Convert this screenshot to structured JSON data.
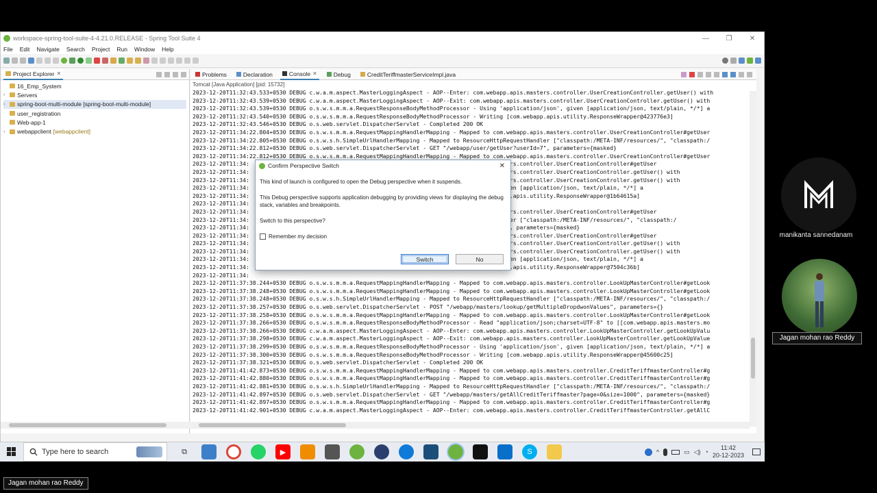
{
  "window": {
    "title": "workspace-spring-tool-suite-4-4.21.0.RELEASE - Spring Tool Suite 4",
    "controls": [
      "—",
      "❐",
      "✕"
    ]
  },
  "menubar": [
    "File",
    "Edit",
    "Navigate",
    "Search",
    "Project",
    "Run",
    "Window",
    "Help"
  ],
  "project_explorer": {
    "tab_label": "Project Explorer",
    "items": [
      {
        "label": "16_Emp_System",
        "sub": ""
      },
      {
        "label": "Servers",
        "sub": ""
      },
      {
        "label": "spring-boot-multi-module [spring-boot-multi-module]",
        "sub": ""
      },
      {
        "label": "user_registration",
        "sub": ""
      },
      {
        "label": "Web-app-1",
        "sub": ""
      },
      {
        "label": "webappclient",
        "sub": "[webappclient]"
      }
    ]
  },
  "editor_tabs": [
    "Problems",
    "Declaration",
    "Console",
    "Debug",
    "CreditTeriffmasterServiceImpl.java"
  ],
  "console": {
    "header": "Tomcat [Java Application]  [pid: 15732]",
    "lines": [
      "2023-12-20T11:32:43.533+0530 DEBUG c.w.a.m.aspect.MasterLoggingAspect - AOP--Enter: com.webapp.apis.masters.controller.UserCreationController.getUser() with",
      "2023-12-20T11:32:43.539+0530 DEBUG c.w.a.m.aspect.MasterLoggingAspect - AOP--Exit: com.webapp.apis.masters.controller.UserCreationController.getUser() with",
      "2023-12-20T11:32:43.539+0530 DEBUG o.s.w.s.m.m.a.RequestResponseBodyMethodProcessor - Using 'application/json', given [application/json, text/plain, */*] a",
      "2023-12-20T11:32:43.540+0530 DEBUG o.s.w.s.m.m.a.RequestResponseBodyMethodProcessor - Writing [com.webapp.apis.utility.ResponseWrapper@423776e3]",
      "2023-12-20T11:32:43.546+0530 DEBUG o.s.web.servlet.DispatcherServlet - Completed 200 OK",
      "2023-12-20T11:34:22.804+0530 DEBUG o.s.w.s.m.m.a.RequestMappingHandlerMapping - Mapped to com.webapp.apis.masters.controller.UserCreationController#getUser",
      "2023-12-20T11:34:22.805+0530 DEBUG o.s.w.s.h.SimpleUrlHandlerMapping - Mapped to ResourceHttpRequestHandler [\"classpath:/META-INF/resources/\", \"classpath:/",
      "2023-12-20T11:34:22.812+0530 DEBUG o.s.web.servlet.DispatcherServlet - GET \"/webapp/user/getUser?userId=7\", parameters={masked}",
      "2023-12-20T11:34:22.812+0530 DEBUG o.s.w.s.m.m.a.RequestMappingHandlerMapping - Mapped to com.webapp.apis.masters.controller.UserCreationController#getUser",
      "2023-12-20T11:34:                                                              ebapp.apis.masters.controller.UserCreationController#getUser",
      "2023-12-20T11:34:                                                              ebapp.apis.masters.controller.UserCreationController.getUser() with",
      "2023-12-20T11:34:                                                              ebapp.apis.masters.controller.UserCreationController.getUser() with",
      "2023-12-20T11:34:                                                              ation/json', given [application/json, text/plain, */*] a",
      "2023-12-20T11:34:                                                              ting [com.webapp.apis.utility.ResponseWrapper@1b64615a]",
      "2023-12-20T11:34:",
      "2023-12-20T11:34:                                                              ebapp.apis.masters.controller.UserCreationController#getUser",
      "2023-12-20T11:34:                                                              HttpRequestHandler [\"classpath:/META-INF/resources/\", \"classpath:/",
      "2023-12-20T11:34:                                                              etUser?userId=7\", parameters={masked}",
      "2023-12-20T11:34:                                                              ebapp.apis.masters.controller.UserCreationController#getUser",
      "2023-12-20T11:34:                                                              ebapp.apis.masters.controller.UserCreationController.getUser() with",
      "2023-12-20T11:34:                                                              ebapp.apis.masters.controller.UserCreationController.getUser() with",
      "2023-12-20T11:34:                                                              ation/json', given [application/json, text/plain, */*] a",
      "2023-12-20T11:34:                                                              ting [com.webapp.apis.utility.ResponseWrapper@7504c36b]",
      "2023-12-20T11:34:",
      "2023-12-20T11:37:38.244+0530 DEBUG o.s.w.s.m.m.a.RequestMappingHandlerMapping - Mapped to com.webapp.apis.masters.controller.LookUpMasterController#getLook",
      "2023-12-20T11:37:38.248+0530 DEBUG o.s.w.s.m.m.a.RequestMappingHandlerMapping - Mapped to com.webapp.apis.masters.controller.LookUpMasterController#getLook",
      "2023-12-20T11:37:38.248+0530 DEBUG o.s.w.s.h.SimpleUrlHandlerMapping - Mapped to ResourceHttpRequestHandler [\"classpath:/META-INF/resources/\", \"classpath:/",
      "2023-12-20T11:37:38.257+0530 DEBUG o.s.web.servlet.DispatcherServlet - POST \"/webapp/masters/lookup/getMultipleDropdwonValues\", parameters={}",
      "2023-12-20T11:37:38.258+0530 DEBUG o.s.w.s.m.m.a.RequestMappingHandlerMapping - Mapped to com.webapp.apis.masters.controller.LookUpMasterController#getLook",
      "2023-12-20T11:37:38.266+0530 DEBUG o.s.w.s.m.m.a.RequestResponseBodyMethodProcessor - Read \"application/json;charset=UTF-8\" to [[com.webapp.apis.masters.mo",
      "2023-12-20T11:37:38.266+0530 DEBUG c.w.a.m.aspect.MasterLoggingAspect - AOP--Enter: com.webapp.apis.masters.controller.LookUpMasterController.getLookUpValu",
      "2023-12-20T11:37:38.298+0530 DEBUG c.w.a.m.aspect.MasterLoggingAspect - AOP--Exit: com.webapp.apis.masters.controller.LookUpMasterController.getLookUpValue",
      "2023-12-20T11:37:38.299+0530 DEBUG o.s.w.s.m.m.a.RequestResponseBodyMethodProcessor - Using 'application/json', given [application/json, text/plain, */*] a",
      "2023-12-20T11:37:38.300+0530 DEBUG o.s.w.s.m.m.a.RequestResponseBodyMethodProcessor - Writing [com.webapp.apis.utility.ResponseWrapper@45600c25]",
      "2023-12-20T11:37:38.321+0530 DEBUG o.s.web.servlet.DispatcherServlet - Completed 200 OK",
      "2023-12-20T11:41:42.873+0530 DEBUG o.s.w.s.m.m.a.RequestMappingHandlerMapping - Mapped to com.webapp.apis.masters.controller.CreditTeriffmasterController#g",
      "2023-12-20T11:41:42.880+0530 DEBUG o.s.w.s.m.m.a.RequestMappingHandlerMapping - Mapped to com.webapp.apis.masters.controller.CreditTeriffmasterController#g",
      "2023-12-20T11:41:42.881+0530 DEBUG o.s.w.s.h.SimpleUrlHandlerMapping - Mapped to ResourceHttpRequestHandler [\"classpath:/META-INF/resources/\", \"classpath:/",
      "2023-12-20T11:41:42.897+0530 DEBUG o.s.web.servlet.DispatcherServlet - GET \"/webapp/masters/getAllCreditTeriffmaster?page=0&size=1000\", parameters={masked}",
      "2023-12-20T11:41:42.897+0530 DEBUG o.s.w.s.m.m.a.RequestMappingHandlerMapping - Mapped to com.webapp.apis.masters.controller.CreditTeriffmasterController#g",
      "2023-12-20T11:41:42.901+0530 DEBUG c.w.a.m.aspect.MasterLoggingAspect - AOP--Enter: com.webapp.apis.masters.controller.CreditTeriffmasterController.getAllC"
    ]
  },
  "dialog": {
    "title": "Confirm Perspective Switch",
    "message1": "This kind of launch is configured to open the Debug perspective when it suspends.",
    "message2": "This Debug perspective supports application debugging by providing views for displaying the debug stack, variables and breakpoints.",
    "question": "Switch to this perspective?",
    "checkbox_label": "Remember my decision",
    "switch_label": "Switch",
    "no_label": "No",
    "close_glyph": "✕"
  },
  "taskbar": {
    "search_placeholder": "Type here to search",
    "time": "11:42",
    "date": "20-12-2023"
  },
  "meeting": {
    "participant1": "manikanta sannedanam",
    "participant2": "Jagan mohan rao Reddy",
    "speaker": "Jagan mohan rao Reddy"
  },
  "colors": {
    "accent": "#3c7fb1",
    "spring_green": "#6db33f"
  }
}
